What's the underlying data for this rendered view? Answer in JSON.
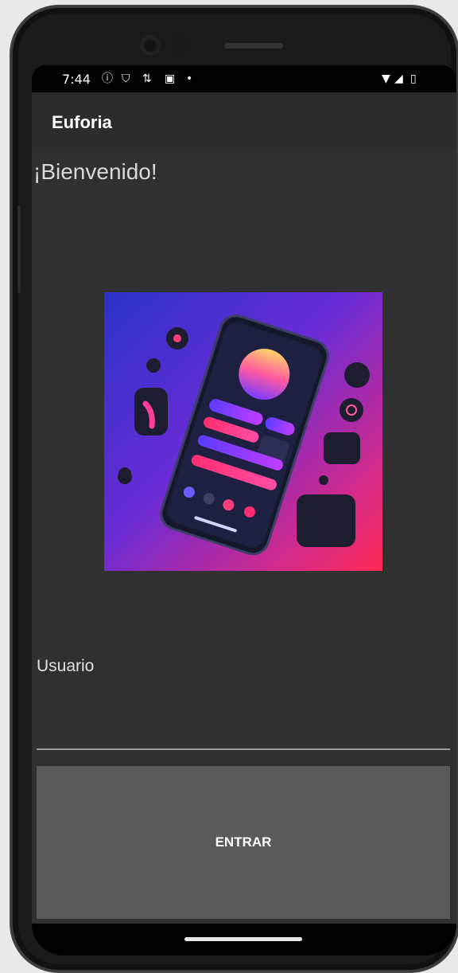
{
  "status_bar": {
    "time": "7:44",
    "icons": [
      "info-icon",
      "shield-icon",
      "network-icon",
      "notification-icon",
      "dot-icon",
      "wifi-icon",
      "signal-icon",
      "battery-icon"
    ]
  },
  "app_bar": {
    "title": "Euforia"
  },
  "main": {
    "welcome_text": "¡Bienvenido!",
    "username_label": "Usuario",
    "enter_button": "ENTRAR"
  },
  "colors": {
    "app_bar_bg": "#2c2c2c",
    "content_bg": "#303030",
    "button_bg": "#5a5a5a",
    "text": "#ffffff"
  }
}
